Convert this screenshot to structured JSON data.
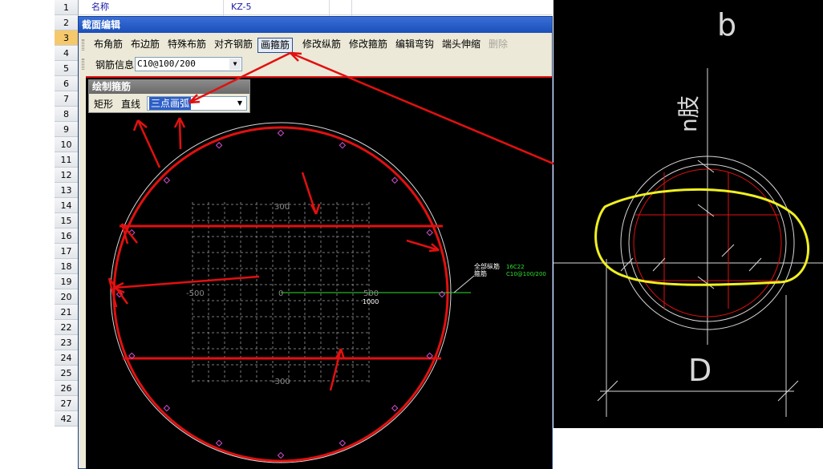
{
  "spreadsheet": {
    "row_numbers": [
      "1",
      "2",
      "3",
      "4",
      "5",
      "6",
      "7",
      "8",
      "9",
      "10",
      "11",
      "12",
      "13",
      "14",
      "15",
      "16",
      "17",
      "18",
      "19",
      "20",
      "21",
      "22",
      "23",
      "24",
      "25",
      "26",
      "27",
      "42"
    ],
    "selected_row": "3",
    "row1_name_label": "名称",
    "row1_name_value": "KZ-5"
  },
  "dialog": {
    "title": "截面编辑",
    "toolbar1": [
      {
        "label": "布角筋"
      },
      {
        "label": "布边筋"
      },
      {
        "label": "特殊布筋"
      },
      {
        "label": "对齐钢筋"
      },
      {
        "label": "画箍筋"
      },
      {
        "label": "修改纵筋"
      },
      {
        "label": "修改箍筋"
      },
      {
        "label": "编辑弯钩"
      },
      {
        "label": "端头伸缩"
      },
      {
        "label": "删除"
      }
    ],
    "rebar_info_label": "钢筋信息",
    "rebar_info_value": "C10@100/200",
    "palette": {
      "title": "绘制箍筋",
      "items": [
        "矩形",
        "直线"
      ],
      "selected": "三点画弧"
    },
    "canvas": {
      "tick_300_top": "300",
      "tick_minus300_bottom": "-300",
      "tick_minus500": "-500",
      "tick_0": "0",
      "tick_500": "500",
      "tick_1000": "1000",
      "legend_label_1": "全部纵筋",
      "legend_value_1": "16C22",
      "legend_label_2": "箍筋",
      "legend_value_2": "C10@100/200"
    }
  },
  "right_panel": {
    "label_b": "b",
    "label_n": "n肢",
    "label_D": "D"
  },
  "colors": {
    "annotation_red": "#e21010",
    "highlight_yellow": "#f0f020",
    "legend_green": "#30e030",
    "dialog_bg": "#ece9d8",
    "titlebar_blue": "#2458c8"
  }
}
